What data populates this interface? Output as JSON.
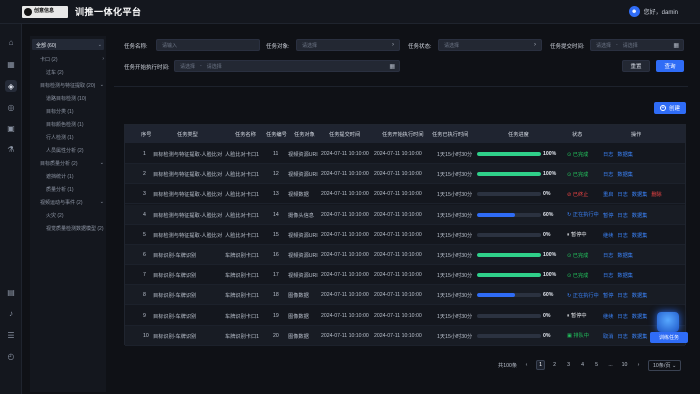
{
  "header": {
    "logo_text": "创意信息",
    "app_title": "训推一体化平台",
    "user_greeting": "您好，damin",
    "user_icon": "user-icon"
  },
  "rail": {
    "icons": [
      "home-icon",
      "grid-icon",
      "model-icon",
      "target-icon",
      "frame-icon",
      "flask-icon",
      "book-icon",
      "bell-icon",
      "sliders-icon",
      "clock-icon"
    ]
  },
  "tree": {
    "root": "全部 (60)",
    "nodes": [
      "卡口 (2)",
      "过车 (2)",
      "目标检测与特征提取 (20)",
      "道路目标检测 (10)",
      "目标分类 (1)",
      "目标颜色检测 (1)",
      "行人检测 (1)",
      "人员属性分析 (2)",
      "目标质量分析 (2)",
      "遮挡统计 (1)",
      "质量分析 (1)",
      "视频运动与事件 (2)",
      "火灾 (2)",
      "视觉质量检测数据模型 (2)"
    ]
  },
  "filters": {
    "task_name_label": "任务名称:",
    "task_name_placeholder": "请输入",
    "task_target_label": "任务对象:",
    "task_target_placeholder": "请选择",
    "task_status_label": "任务状态:",
    "task_status_placeholder": "请选择",
    "submit_time_label": "任务提交时间:",
    "range_start_placeholder": "请选择",
    "range_sep": "-",
    "range_end_placeholder": "请选择",
    "start_time_label": "任务开始执行时间:",
    "reset_label": "重置",
    "query_label": "查询",
    "create_label": "创建"
  },
  "table": {
    "headers": [
      "序号",
      "任务类型",
      "任务名称",
      "任务编号",
      "任务对象",
      "任务提交时间",
      "任务开始执行时间",
      "任务已执行时间",
      "任务进度",
      "状态",
      "操作"
    ],
    "rows": [
      {
        "no": "1",
        "type": "目标检测与特征提取-人脸比对",
        "name": "人脸比对卡口1",
        "id": "11",
        "target": "视频资源URI",
        "submit": "2024-07-11  10:10:00",
        "start": "2024-07-11  10:10:00",
        "elapsed": "1天15小时30分",
        "progress": 100,
        "pct_text": "100%",
        "status": "已完成",
        "status_color": "#22c55e",
        "status_icon": "check-circle-icon",
        "ops": [
          "日志",
          "数据集"
        ],
        "bar_color": "#2fd08a"
      },
      {
        "no": "2",
        "type": "目标检测与特征提取-人脸比对",
        "name": "人脸比对卡口1",
        "id": "12",
        "target": "视频资源URI",
        "submit": "2024-07-11  10:10:00",
        "start": "2024-07-11  10:10:00",
        "elapsed": "1天15小时30分",
        "progress": 100,
        "pct_text": "100%",
        "status": "已完成",
        "status_color": "#22c55e",
        "status_icon": "check-circle-icon",
        "ops": [
          "日志",
          "数据集"
        ],
        "bar_color": "#2fd08a"
      },
      {
        "no": "3",
        "type": "目标检测与特征提取-人脸比对",
        "name": "人脸比对卡口1",
        "id": "13",
        "target": "视频数据",
        "submit": "2024-07-11  10:10:00",
        "start": "2024-07-11  10:10:00",
        "elapsed": "1天15小时30分",
        "progress": 0,
        "pct_text": "0%",
        "status": "已终止",
        "status_color": "#ef4444",
        "status_icon": "stop-circle-icon",
        "ops": [
          "重启",
          "日志",
          "数据集",
          "删除"
        ],
        "bar_color": "#2f6cf6"
      },
      {
        "no": "4",
        "type": "目标检测与特征提取-人脸比对",
        "name": "人脸比对卡口1",
        "id": "14",
        "target": "摄像头信息",
        "submit": "2024-07-11  10:10:00",
        "start": "2024-07-11  10:10:00",
        "elapsed": "1天15小时30分",
        "progress": 60,
        "pct_text": "60%",
        "status": "正在执行中",
        "status_color": "#3b82f6",
        "status_icon": "refresh-icon",
        "ops": [
          "暂停",
          "日志",
          "数据集"
        ],
        "bar_color": "#2f6cf6"
      },
      {
        "no": "5",
        "type": "目标检测与特征提取-人脸比对",
        "name": "人脸比对卡口1",
        "id": "15",
        "target": "视频资源URI",
        "submit": "2024-07-11  10:10:00",
        "start": "2024-07-11  10:10:00",
        "elapsed": "1天15小时30分",
        "progress": 0,
        "pct_text": "0%",
        "status": "暂停中",
        "status_color": "#e5e7eb",
        "status_icon": "pause-circle-icon",
        "ops": [
          "继续",
          "日志",
          "数据集"
        ],
        "bar_color": "#2f6cf6"
      },
      {
        "no": "6",
        "type": "目标识别-车牌识别",
        "name": "车牌识别卡口1",
        "id": "16",
        "target": "视频资源URI",
        "submit": "2024-07-11  10:10:00",
        "start": "2024-07-11  10:10:00",
        "elapsed": "1天15小时30分",
        "progress": 100,
        "pct_text": "100%",
        "status": "已完成",
        "status_color": "#22c55e",
        "status_icon": "check-circle-icon",
        "ops": [
          "日志",
          "数据集"
        ],
        "bar_color": "#2fd08a"
      },
      {
        "no": "7",
        "type": "目标识别-车牌识别",
        "name": "车牌识别卡口1",
        "id": "17",
        "target": "视频资源URI",
        "submit": "2024-07-11  10:10:00",
        "start": "2024-07-11  10:10:00",
        "elapsed": "1天15小时30分",
        "progress": 100,
        "pct_text": "100%",
        "status": "已完成",
        "status_color": "#22c55e",
        "status_icon": "check-circle-icon",
        "ops": [
          "日志",
          "数据集"
        ],
        "bar_color": "#2fd08a"
      },
      {
        "no": "8",
        "type": "目标识别-车牌识别",
        "name": "车牌识别卡口1",
        "id": "18",
        "target": "图像数据",
        "submit": "2024-07-11  10:10:00",
        "start": "2024-07-11  10:10:00",
        "elapsed": "1天15小时30分",
        "progress": 60,
        "pct_text": "60%",
        "status": "正在执行中",
        "status_color": "#3b82f6",
        "status_icon": "refresh-icon",
        "ops": [
          "暂停",
          "日志",
          "数据集"
        ],
        "bar_color": "#2f6cf6"
      },
      {
        "no": "9",
        "type": "目标识别-车牌识别",
        "name": "车牌识别卡口1",
        "id": "19",
        "target": "图像数据",
        "submit": "2024-07-11  10:10:00",
        "start": "2024-07-11  10:10:00",
        "elapsed": "1天15小时30分",
        "progress": 0,
        "pct_text": "0%",
        "status": "暂停中",
        "status_color": "#e5e7eb",
        "status_icon": "pause-circle-icon",
        "ops": [
          "继续",
          "日志",
          "数据集"
        ],
        "bar_color": "#2f6cf6"
      },
      {
        "no": "10",
        "type": "目标识别-车牌识别",
        "name": "车牌识别卡口1",
        "id": "20",
        "target": "图像数据",
        "submit": "2024-07-11  10:10:00",
        "start": "2024-07-11  10:10:00",
        "elapsed": "1天15小时30分",
        "progress": 0,
        "pct_text": "0%",
        "status": "排队中",
        "status_color": "#22c55e",
        "status_icon": "queue-icon",
        "ops": [
          "取消",
          "日志",
          "数据集"
        ],
        "bar_color": "#2f6cf6"
      }
    ]
  },
  "pagination": {
    "total": "共100条",
    "prev": "‹",
    "pages": [
      "1",
      "2",
      "3",
      "4",
      "5",
      "...",
      "10"
    ],
    "next": "›",
    "page_size": "10条/页 ⌄"
  },
  "fab": {
    "label": "训练任务"
  },
  "colors": {
    "accent": "#2f6cf6",
    "success": "#22c55e",
    "danger": "#ef4444",
    "link": "#3b82f6"
  }
}
